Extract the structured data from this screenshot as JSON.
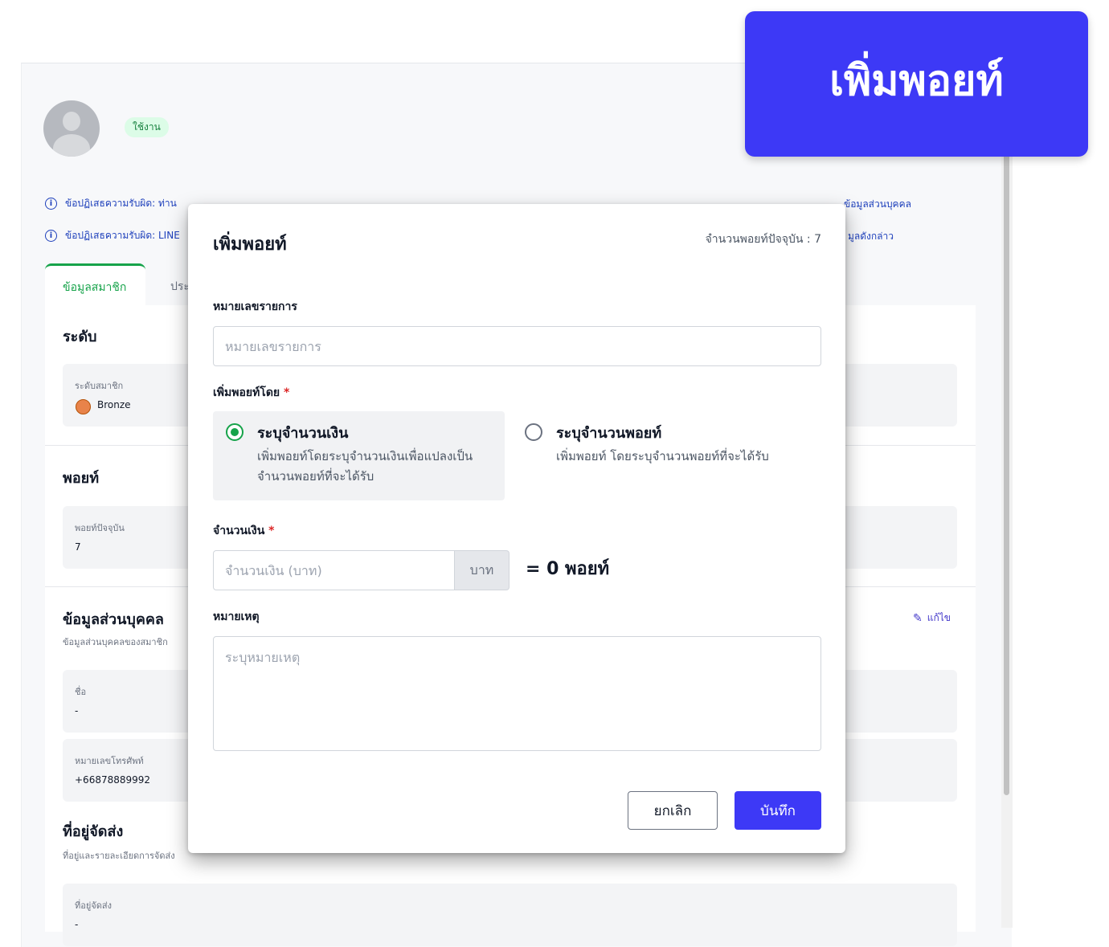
{
  "profile": {
    "status": "ใช้งาน"
  },
  "disclaimers": [
    {
      "left": "ข้อปฏิเสธความรับผิด: ท่าน",
      "right": "ข้อมูลส่วนบุคคล"
    },
    {
      "left": "ข้อปฏิเสธความรับผิด: LINE",
      "right": "มูลดังกล่าว"
    }
  ],
  "tabs": [
    {
      "label": "ข้อมูลสมาชิก",
      "active": true
    },
    {
      "label": "ประ",
      "active": false
    }
  ],
  "sections": {
    "level": {
      "title": "ระดับ",
      "field_label": "ระดับสมาชิก",
      "field_value": "Bronze"
    },
    "points": {
      "title": "พอยท์",
      "field_label": "พอยท์ปัจจุบัน",
      "field_value": "7"
    },
    "personal": {
      "title": "ข้อมูลส่วนบุคคล",
      "subtitle": "ข้อมูลส่วนบุคคลของสมาชิก",
      "edit_label": "แก้ไข",
      "name_label": "ชื่อ",
      "name_value": "-",
      "phone_label": "หมายเลขโทรศัพท์",
      "phone_value": "+66878889992"
    },
    "shipping": {
      "title": "ที่อยู่จัดส่ง",
      "subtitle": "ที่อยู่และรายละเอียดการจัดส่ง",
      "field_label": "ที่อยู่จัดส่ง",
      "field_value": "-"
    }
  },
  "hero_button": {
    "label": "เพิ่มพอยท์"
  },
  "modal": {
    "title": "เพิ่มพอยท์",
    "current_points_text": "จำนวนพอยท์ปัจจุบัน : 7",
    "ref_label": "หมายเลขรายการ",
    "ref_placeholder": "หมายเลขรายการ",
    "add_by_label": "เพิ่มพอยท์โดย",
    "required_mark": "*",
    "options": [
      {
        "title": "ระบุจำนวนเงิน",
        "desc": "เพิ่มพอยท์โดยระบุจำนวนเงินเพื่อแปลงเป็นจำนวนพอยท์ที่จะได้รับ",
        "selected": true
      },
      {
        "title": "ระบุจำนวนพอยท์",
        "desc": "เพิ่มพอยท์ โดยระบุจำนวนพอยท์ที่จะได้รับ",
        "selected": false
      }
    ],
    "amount_label": "จำนวนเงิน",
    "amount_placeholder": "จำนวนเงิน (บาท)",
    "amount_unit": "บาท",
    "equals_text": "= 0 พอยท์",
    "note_label": "หมายเหตุ",
    "note_placeholder": "ระบุหมายเหตุ",
    "cancel_label": "ยกเลิก",
    "save_label": "บันทึก"
  },
  "colors": {
    "accent": "#3d39f6",
    "success": "#16a34a",
    "link": "#1d3fbb"
  }
}
